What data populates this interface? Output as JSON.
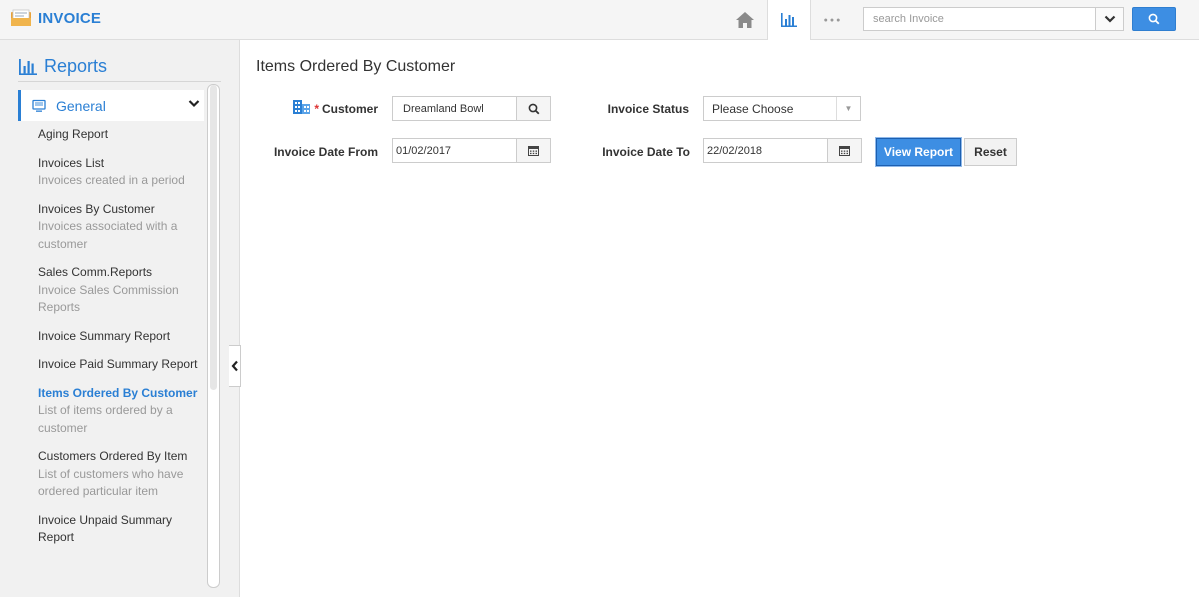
{
  "app": {
    "title": "INVOICE"
  },
  "header": {
    "search_placeholder": "search Invoice",
    "more_label": "●●●"
  },
  "sidebar": {
    "section_title": "Reports",
    "group_label": "General",
    "items": [
      {
        "title": "Aging Report",
        "subtitle": ""
      },
      {
        "title": "Invoices List",
        "subtitle": "Invoices created in a period"
      },
      {
        "title": "Invoices By Customer",
        "subtitle": "Invoices associated with a customer"
      },
      {
        "title": "Sales Comm.Reports",
        "subtitle": "Invoice Sales Commission Reports"
      },
      {
        "title": "Invoice Summary Report",
        "subtitle": ""
      },
      {
        "title": "Invoice Paid Summary Report",
        "subtitle": ""
      },
      {
        "title": "Items Ordered By Customer",
        "subtitle": "List of items ordered by a customer"
      },
      {
        "title": "Customers Ordered By Item",
        "subtitle": "List of customers who have ordered particular item"
      },
      {
        "title": "Invoice Unpaid Summary Report",
        "subtitle": ""
      }
    ],
    "active_index": 6
  },
  "main": {
    "title": "Items Ordered By Customer",
    "form": {
      "customer_label": "Customer",
      "customer_required_mark": "*",
      "customer_value": "Dreamland Bowl",
      "status_label": "Invoice Status",
      "status_value": "Please Choose",
      "date_from_label": "Invoice Date From",
      "date_from_value": "01/02/2017",
      "date_to_label": "Invoice Date To",
      "date_to_value": "22/02/2018",
      "view_report_label": "View Report",
      "reset_label": "Reset"
    }
  },
  "colors": {
    "accent": "#2a7fd4",
    "primary_button": "#3d8ee3"
  }
}
